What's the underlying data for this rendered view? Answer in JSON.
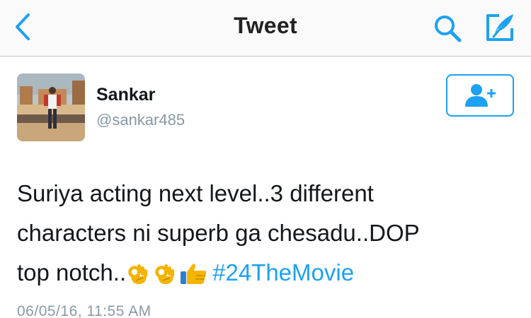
{
  "nav": {
    "title": "Tweet"
  },
  "user": {
    "display_name": "Sankar",
    "handle": "@sankar485"
  },
  "tweet": {
    "text_line1": "Suriya acting next level..3 different",
    "text_line2": "characters ni superb ga chesadu..DOP",
    "text_line3_start": "top notch..",
    "hashtag": "#24TheMovie",
    "timestamp": "06/05/16, 11:55 AM"
  },
  "icons": {
    "back": "chevron-left",
    "search": "magnifier",
    "compose": "quill-compose",
    "follow": "add-person",
    "emojis": [
      "ok-hand",
      "ok-hand",
      "thumbs-up"
    ]
  },
  "colors": {
    "accent": "#1da1f2",
    "secondary_text": "#8899a6",
    "nav_background": "#fafafa"
  }
}
